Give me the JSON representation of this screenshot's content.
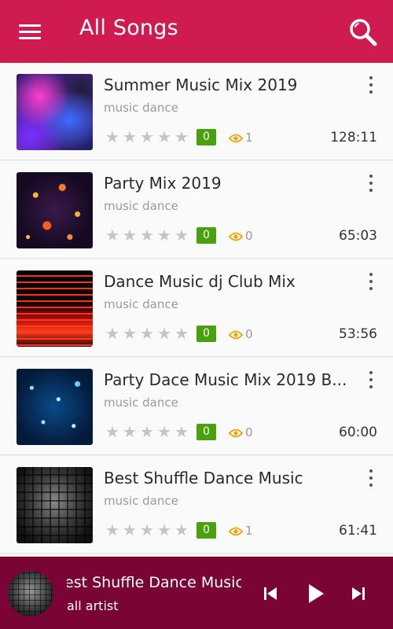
{
  "app": {
    "title": "All Songs",
    "theme_color": "#cf1b4f",
    "player_color": "#7a0436",
    "icons": [
      "menu-icon",
      "search-icon",
      "more-vertical-icon",
      "star-icon",
      "eye-icon",
      "skip-previous-icon",
      "play-icon",
      "skip-next-icon"
    ]
  },
  "songs": [
    {
      "title": "Summer Music Mix 2019",
      "subtitle": "music dance",
      "rating_badge": "0",
      "views": "1",
      "duration": "128:11",
      "rating": 0
    },
    {
      "title": "Party Mix 2019",
      "subtitle": "music dance",
      "rating_badge": "0",
      "views": "0",
      "duration": "65:03",
      "rating": 0
    },
    {
      "title": "Dance Music dj Club Mix",
      "subtitle": "music dance",
      "rating_badge": "0",
      "views": "0",
      "duration": "53:56",
      "rating": 0
    },
    {
      "title": "Party Dace Music Mix 2019 B...",
      "subtitle": "music dance",
      "rating_badge": "0",
      "views": "0",
      "duration": "60:00",
      "rating": 0
    },
    {
      "title": "Best Shuffle Dance Music",
      "subtitle": "music dance",
      "rating_badge": "0",
      "views": "1",
      "duration": "61:41",
      "rating": 0
    }
  ],
  "player": {
    "title": "Best Shuffle Dance Music",
    "artist": "all artist"
  }
}
